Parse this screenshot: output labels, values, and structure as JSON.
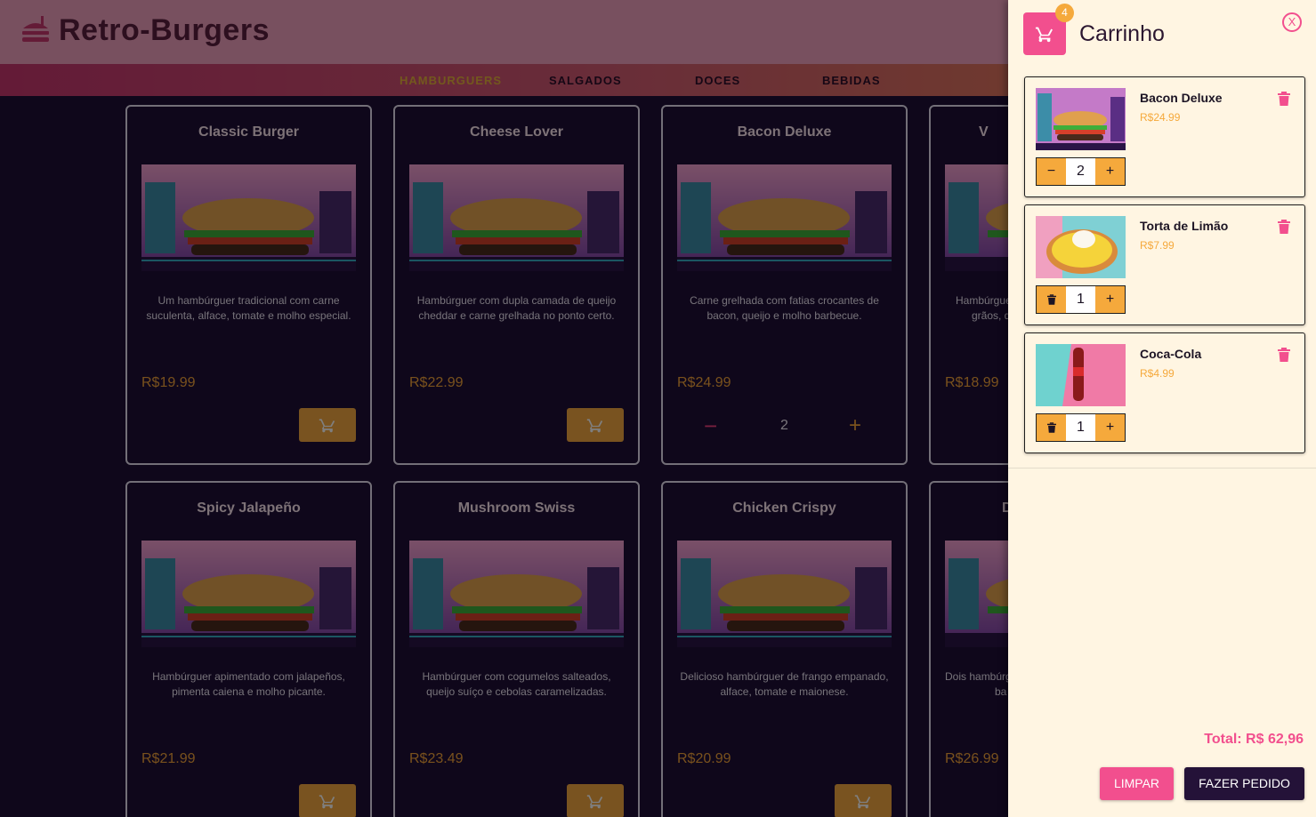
{
  "brand": {
    "name": "Retro-Burgers"
  },
  "nav": {
    "items": [
      {
        "label": "HAMBURGUERS",
        "active": true
      },
      {
        "label": "SALGADOS",
        "active": false
      },
      {
        "label": "DOCES",
        "active": false
      },
      {
        "label": "BEBIDAS",
        "active": false
      }
    ]
  },
  "products": [
    {
      "title": "Classic Burger",
      "desc1": "Um hambúrguer tradicional com carne",
      "desc2": "suculenta, alface, tomate e molho especial.",
      "price": "R$19.99",
      "qty": null
    },
    {
      "title": "Cheese Lover",
      "desc1": "Hambúrguer com dupla camada de queijo",
      "desc2": "cheddar e carne grelhada no ponto certo.",
      "price": "R$22.99",
      "qty": null
    },
    {
      "title": "Bacon Deluxe",
      "desc1": "Carne grelhada com fatias crocantes de",
      "desc2": "bacon, queijo e molho barbecue.",
      "price": "R$24.99",
      "qty": "2"
    },
    {
      "title": "V",
      "desc1": "Hambúrgue",
      "desc2": "grãos, q",
      "price": "R$18.99",
      "qty": null
    },
    {
      "title": "Spicy Jalapeño",
      "desc1": "Hambúrguer apimentado com jalapeños,",
      "desc2": "pimenta caiena e molho picante.",
      "price": "R$21.99",
      "qty": null
    },
    {
      "title": "Mushroom Swiss",
      "desc1": "Hambúrguer com cogumelos salteados,",
      "desc2": "queijo suíço e cebolas caramelizadas.",
      "price": "R$23.49",
      "qty": null
    },
    {
      "title": "Chicken Crispy",
      "desc1": "Delicioso hambúrguer de frango empanado,",
      "desc2": "alface, tomate e maionese.",
      "price": "R$20.99",
      "qty": null
    },
    {
      "title": "D",
      "desc1": "Dois hambúrg",
      "desc2": "ba",
      "price": "R$26.99",
      "qty": null
    }
  ],
  "cart": {
    "title": "Carrinho",
    "badge": "4",
    "close_label": "X",
    "items": [
      {
        "name": "Bacon Deluxe",
        "price": "R$24.99",
        "qty": "2",
        "left_control": "minus",
        "image": "burger-image"
      },
      {
        "name": "Torta de Limão",
        "price": "R$7.99",
        "qty": "1",
        "left_control": "trash",
        "image": "lemon-tart-image"
      },
      {
        "name": "Coca-Cola",
        "price": "R$4.99",
        "qty": "1",
        "left_control": "trash",
        "image": "coca-cola-image"
      }
    ],
    "total": "Total: R$ 62,96",
    "clear_label": "LIMPAR",
    "order_label": "FAZER PEDIDO"
  },
  "colors": {
    "accent_pink": "#f24f8e",
    "accent_orange": "#f5a93c",
    "drawer_bg": "#fff5e2",
    "page_bg": "#1e0f36",
    "dark_button": "#241238"
  },
  "icons": [
    "cart-icon",
    "trash-icon",
    "plus-icon",
    "minus-icon",
    "close-icon",
    "burger-logo-icon"
  ]
}
